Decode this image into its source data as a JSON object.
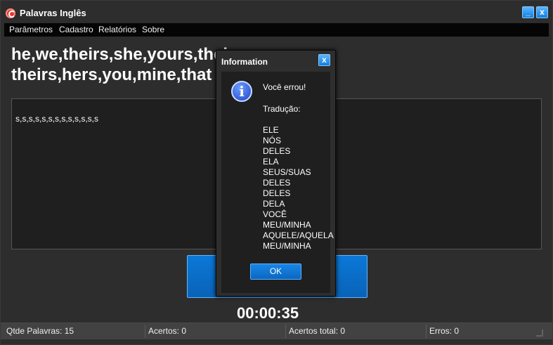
{
  "window": {
    "title": "Palavras Inglês",
    "minimize_label": "_",
    "close_label": "x"
  },
  "menu": {
    "items": [
      "Parâmetros",
      "Cadastro",
      "Relatórios",
      "Sobre"
    ]
  },
  "main": {
    "words_line1": "he,we,theirs,she,yours,thei",
    "words_line2": "theirs,hers,you,mine,that",
    "typed_text": "s,s,s,s,s,s,s,s,s,s,s,s,s",
    "timer": "00:00:35"
  },
  "status": {
    "qtde_palavras": "Qtde Palavras: 15",
    "acertos": "Acertos: 0",
    "acertos_total": "Acertos total: 0",
    "erros": "Erros: 0"
  },
  "dialog": {
    "title": "Information",
    "close_label": "x",
    "icon": "info-icon",
    "icon_glyph": "i",
    "message": "Você errou!",
    "translation_label": "Tradução:",
    "translations": [
      "ELE",
      "NÓS",
      "DELES",
      "ELA",
      "SEUS/SUAS",
      "DELES",
      "DELES",
      "DELA",
      "VOCÊ",
      "MEU/MINHA",
      "AQUELE/AQUELA",
      "MEU/MINHA"
    ],
    "ok_label": "OK"
  },
  "colors": {
    "accent": "#0a6fd0",
    "background": "#2d2d2d"
  }
}
